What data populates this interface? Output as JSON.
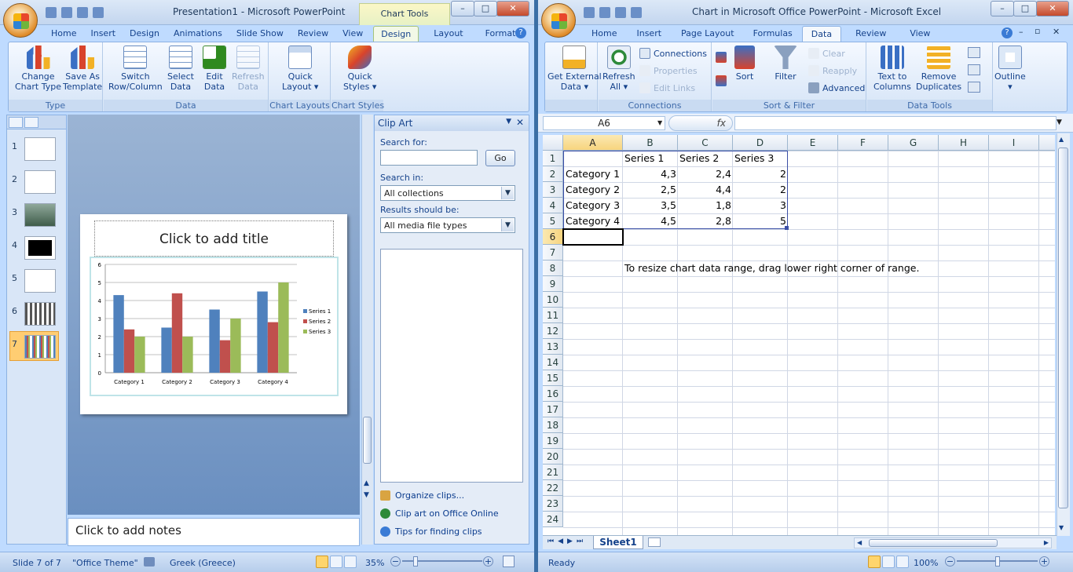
{
  "ppt": {
    "title": "Presentation1 - Microsoft PowerPoint",
    "context_tab": "Chart Tools",
    "tabs": [
      "Home",
      "Insert",
      "Design",
      "Animations",
      "Slide Show",
      "Review",
      "View",
      "Design",
      "Layout",
      "Format"
    ],
    "groups": {
      "type": {
        "label": "Type",
        "b1": "Change",
        "b1b": "Chart Type",
        "b2": "Save As",
        "b2b": "Template"
      },
      "data": {
        "label": "Data",
        "b1": "Switch",
        "b1b": "Row/Column",
        "b2": "Select",
        "b2b": "Data",
        "b3": "Edit",
        "b3b": "Data",
        "b4": "Refresh",
        "b4b": "Data"
      },
      "layouts": {
        "label": "Chart Layouts",
        "b1": "Quick",
        "b1b": "Layout ▾"
      },
      "styles": {
        "label": "Chart Styles",
        "b1": "Quick",
        "b1b": "Styles ▾"
      }
    },
    "slides": [
      "1",
      "2",
      "3",
      "4",
      "5",
      "6",
      "7"
    ],
    "slide_title": "Click to add title",
    "notes": "Click to add notes",
    "clip_art": {
      "header": "Clip Art",
      "search_label": "Search for:",
      "search_value": "",
      "go": "Go",
      "search_in_label": "Search in:",
      "search_in": "All collections",
      "results_label": "Results should be:",
      "results": "All media file types",
      "link1": "Organize clips...",
      "link2": "Clip art on Office Online",
      "link3": "Tips for finding clips"
    },
    "status": {
      "slide": "Slide 7 of 7",
      "theme": "\"Office Theme\"",
      "language": "Greek (Greece)",
      "zoom": "35%"
    }
  },
  "chart_data": {
    "type": "bar",
    "categories": [
      "Category 1",
      "Category 2",
      "Category 3",
      "Category 4"
    ],
    "series": [
      {
        "name": "Series 1",
        "values": [
          4.3,
          2.5,
          3.5,
          4.5
        ],
        "color": "#4f81bd"
      },
      {
        "name": "Series 2",
        "values": [
          2.4,
          4.4,
          1.8,
          2.8
        ],
        "color": "#c0504d"
      },
      {
        "name": "Series 3",
        "values": [
          2,
          2,
          3,
          5
        ],
        "color": "#9bbb59"
      }
    ],
    "ylim": [
      0,
      6
    ],
    "yticks": [
      "0",
      "1",
      "2",
      "3",
      "4",
      "5",
      "6"
    ],
    "legend": "right",
    "grid": true
  },
  "excel": {
    "title": "Chart in Microsoft Office PowerPoint - Microsoft Excel",
    "tabs": [
      "Home",
      "Insert",
      "Page Layout",
      "Formulas",
      "Data",
      "Review",
      "View"
    ],
    "groups": {
      "get": {
        "label": "",
        "b1": "Get External",
        "b1b": "Data ▾"
      },
      "connections": {
        "label": "Connections",
        "refresh": "Refresh",
        "refreshb": "All ▾",
        "c1": "Connections",
        "c2": "Properties",
        "c3": "Edit Links"
      },
      "sort": {
        "label": "Sort & Filter",
        "sort": "Sort",
        "filter": "Filter",
        "clear": "Clear",
        "reapply": "Reapply",
        "advanced": "Advanced"
      },
      "tools": {
        "label": "Data Tools",
        "t1": "Text to",
        "t1b": "Columns",
        "t2": "Remove",
        "t2b": "Duplicates"
      },
      "outline": {
        "b1": "Outline",
        "b1b": "▾"
      }
    },
    "name_box": "A6",
    "fx": "fx",
    "columns": [
      "A",
      "B",
      "C",
      "D",
      "E",
      "F",
      "G",
      "H",
      "I"
    ],
    "rows": [
      "1",
      "2",
      "3",
      "4",
      "5",
      "6",
      "7",
      "8",
      "9",
      "10",
      "11",
      "12",
      "13",
      "14",
      "15",
      "16",
      "17",
      "18",
      "19",
      "20",
      "21",
      "22",
      "23",
      "24"
    ],
    "cells": {
      "b1": "Series 1",
      "c1": "Series 2",
      "d1": "Series 3",
      "a2": "Category 1",
      "b2": "4,3",
      "c2": "2,4",
      "d2": "2",
      "a3": "Category 2",
      "b3": "2,5",
      "c3": "4,4",
      "d3": "2",
      "a4": "Category 3",
      "b4": "3,5",
      "c4": "1,8",
      "d4": "3",
      "a5": "Category 4",
      "b5": "4,5",
      "c5": "2,8",
      "d5": "5",
      "b8": "To resize chart data range, drag lower right corner of range."
    },
    "sheet_tab": "Sheet1",
    "status": {
      "ready": "Ready",
      "zoom": "100%"
    }
  }
}
